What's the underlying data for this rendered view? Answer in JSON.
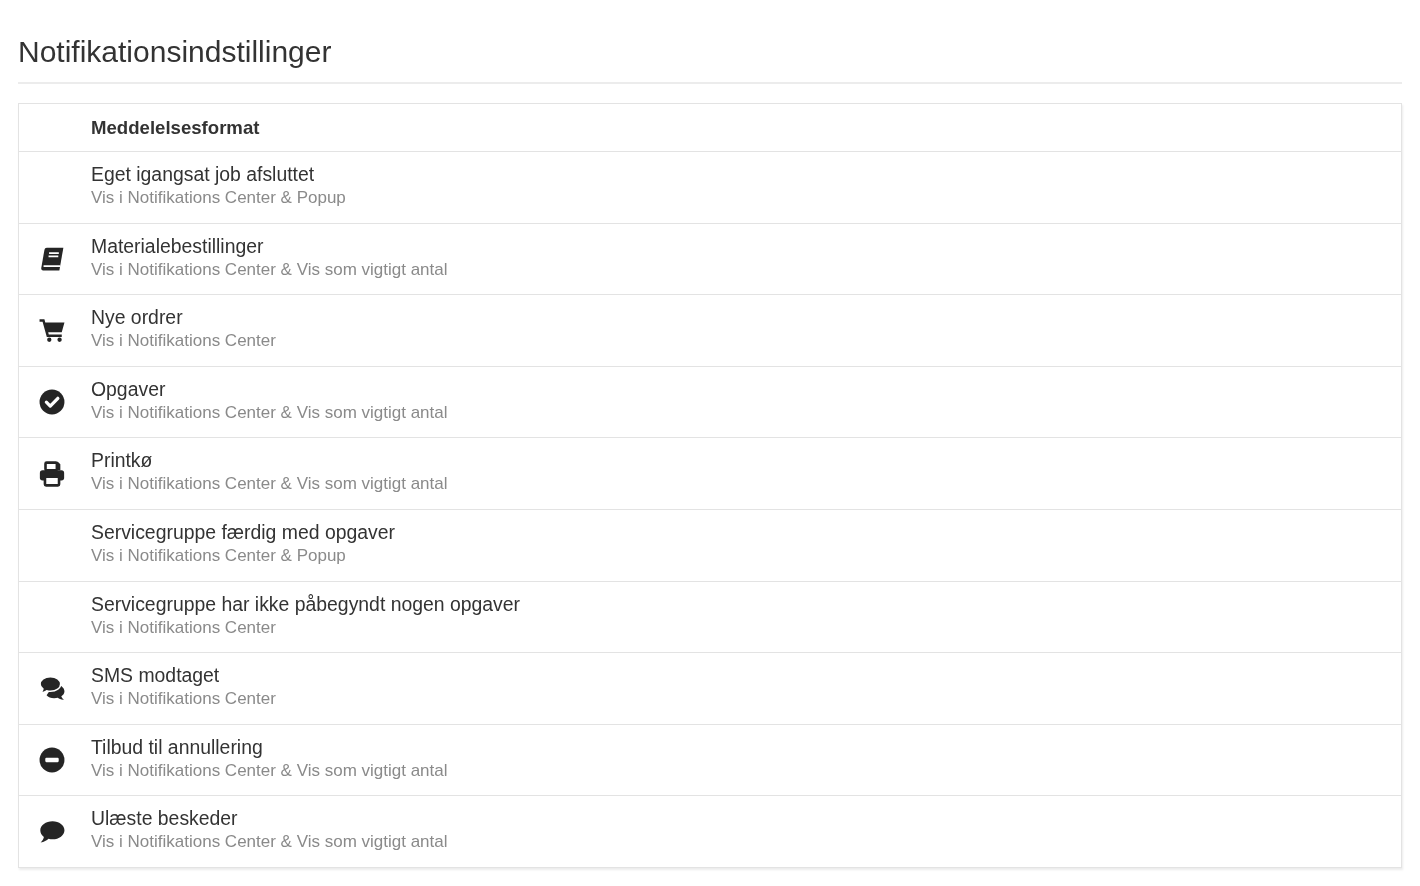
{
  "page": {
    "title": "Notifikationsindstillinger"
  },
  "table": {
    "column_header": "Meddelelsesformat",
    "rows": [
      {
        "kind": "plain",
        "title": "Eget igangsat job afsluttet",
        "format": "Vis i Notifikations Center & Popup"
      },
      {
        "kind": "book",
        "title": "Materialebestillinger",
        "format": "Vis i Notifikations Center & Vis som vigtigt antal"
      },
      {
        "kind": "cart",
        "title": "Nye ordrer",
        "format": "Vis i Notifikations Center"
      },
      {
        "kind": "check",
        "title": "Opgaver",
        "format": "Vis i Notifikations Center & Vis som vigtigt antal"
      },
      {
        "kind": "printer",
        "title": "Printkø",
        "format": "Vis i Notifikations Center & Vis som vigtigt antal"
      },
      {
        "kind": "plain",
        "title": "Servicegruppe færdig med opgaver",
        "format": "Vis i Notifikations Center & Popup"
      },
      {
        "kind": "plain",
        "title": "Servicegruppe har ikke påbegyndt nogen opgaver",
        "format": "Vis i Notifikations Center"
      },
      {
        "kind": "chats",
        "title": "SMS modtaget",
        "format": "Vis i Notifikations Center"
      },
      {
        "kind": "minus",
        "title": "Tilbud til annullering",
        "format": "Vis i Notifikations Center & Vis som vigtigt antal"
      },
      {
        "kind": "chat",
        "title": "Ulæste beskeder",
        "format": "Vis i Notifikations Center & Vis som vigtigt antal"
      }
    ]
  }
}
